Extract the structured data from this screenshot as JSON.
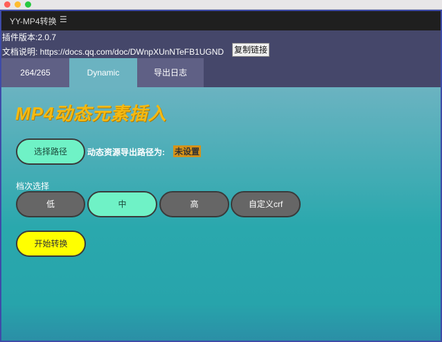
{
  "window": {
    "panel_title": "YY-MP4转换",
    "menu_icon": "hamburger-menu-icon",
    "menu_glyph": "☰"
  },
  "info": {
    "version": "插件版本:2.0.7",
    "docs": "文档说明:   https://docs.qq.com/doc/DWnpXUnNTeFB1UGND",
    "copy_button": "复制链接"
  },
  "tabs": [
    {
      "label": "264/265"
    },
    {
      "label": "Dynamic"
    },
    {
      "label": "导出日志"
    }
  ],
  "main": {
    "title": "MP4动态元素插入",
    "select_path_button": "选择路径",
    "export_path_label": "动态资源导出路径为:",
    "export_path_value": "未设置",
    "quality_label": "档次选择",
    "quality_options": [
      {
        "label": "低"
      },
      {
        "label": "中"
      },
      {
        "label": "高"
      },
      {
        "label": "自定义crf"
      }
    ],
    "start_button": "开始转换"
  },
  "colors": {
    "accent_mint": "#6ff2c6",
    "start_yellow": "#ffff00",
    "warning_badge": "#d4921a",
    "title_gold": "#f4b912"
  }
}
